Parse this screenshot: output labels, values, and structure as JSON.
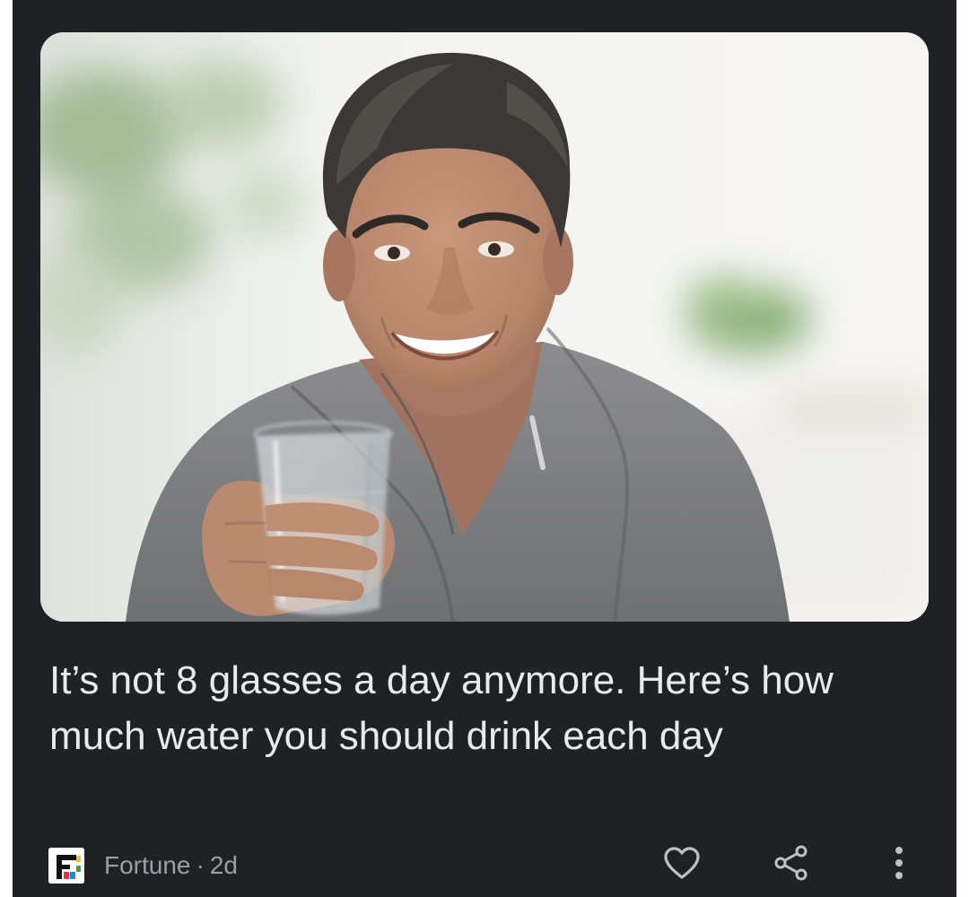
{
  "article": {
    "headline": "It’s not 8 glasses a day anymore. Here’s how much water you should drink each day",
    "source": "Fortune",
    "separator": "·",
    "age": "2d",
    "image_subject": "man-holding-water-glass"
  },
  "actions": {
    "like_icon": "heart-icon",
    "share_icon": "share-icon",
    "more_icon": "more-vert-icon"
  },
  "colors": {
    "card_background": "#202124",
    "headline_text": "#e8eaed",
    "meta_text": "#9aa0a6",
    "icon": "#bdc1c6"
  }
}
